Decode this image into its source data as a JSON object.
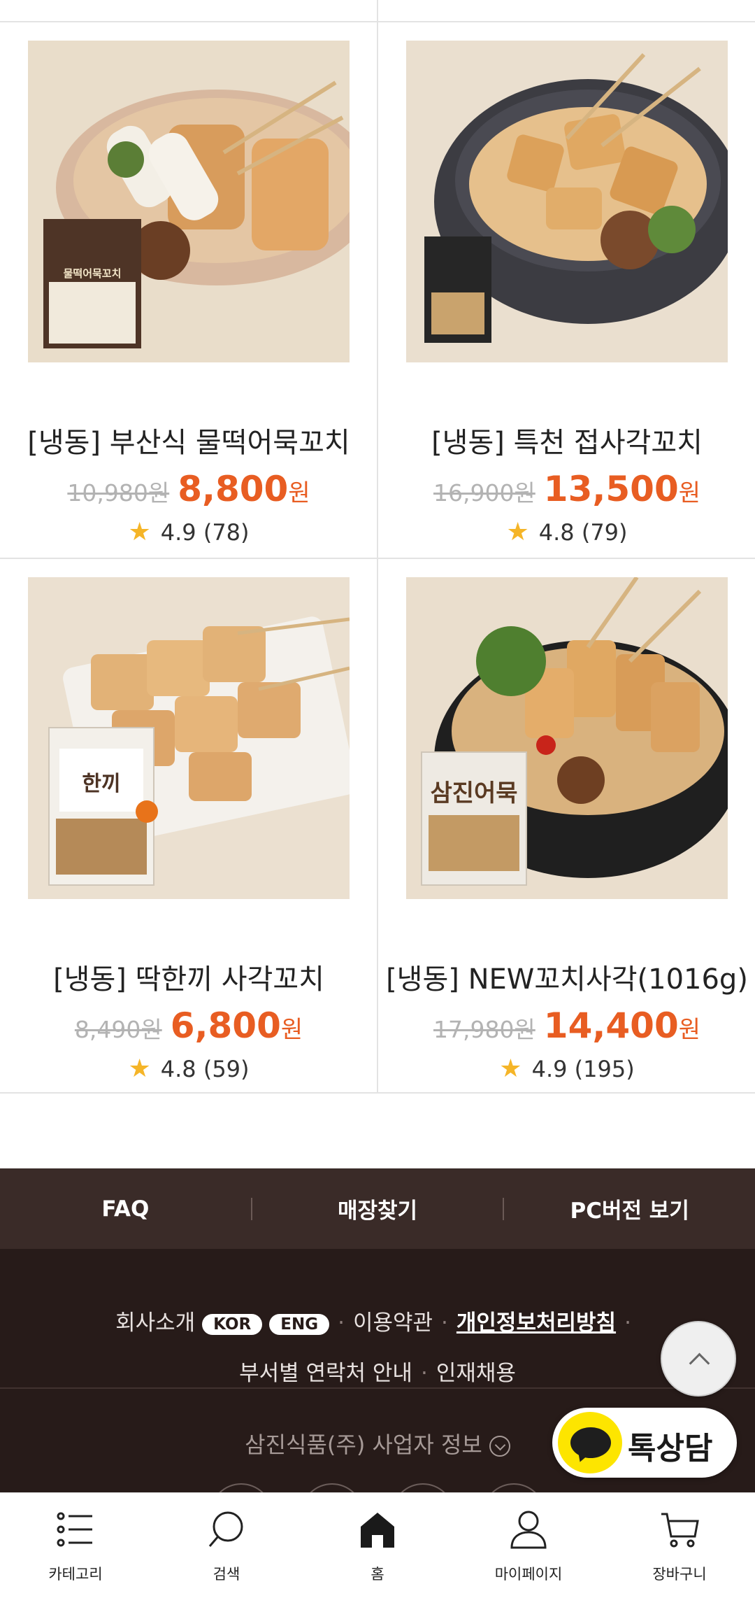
{
  "products": [
    {
      "name": "[냉동] 부산식 물떡어묵꼬치",
      "original_price": "10,980원",
      "sale_price": "8,800",
      "currency": "원",
      "rating": "4.9",
      "reviews": "(78)",
      "package_text": "물떡어묵꼬치"
    },
    {
      "name": "[냉동] 특천 접사각꼬치",
      "original_price": "16,900원",
      "sale_price": "13,500",
      "currency": "원",
      "rating": "4.8",
      "reviews": "(79)"
    },
    {
      "name": "[냉동] 딱한끼 사각꼬치",
      "original_price": "8,490원",
      "sale_price": "6,800",
      "currency": "원",
      "rating": "4.8",
      "reviews": "(59)",
      "package_text": "한끼"
    },
    {
      "name": "[냉동] NEW꼬치사각(1016g)",
      "original_price": "17,980원",
      "sale_price": "14,400",
      "currency": "원",
      "rating": "4.9",
      "reviews": "(195)",
      "package_text": "삼진어묵"
    }
  ],
  "footer_nav": [
    "FAQ",
    "매장찾기",
    "PC버전 보기"
  ],
  "footer_links": {
    "company": "회사소개",
    "kor": "KOR",
    "eng": "ENG",
    "terms": "이용약관",
    "privacy": "개인정보처리방침",
    "contact": "부서별 연락처 안내",
    "careers": "인재채용"
  },
  "business_info": "삼진식품(주) 사업자 정보",
  "talk_label": "톡상담",
  "tabbar": [
    {
      "label": "카테고리",
      "icon": "list-icon"
    },
    {
      "label": "검색",
      "icon": "search-icon"
    },
    {
      "label": "홈",
      "icon": "home-icon"
    },
    {
      "label": "마이페이지",
      "icon": "user-icon"
    },
    {
      "label": "장바구니",
      "icon": "cart-icon"
    }
  ],
  "colors": {
    "sale": "#e85d22",
    "star": "#f5b528",
    "footer_bg": "#271b19",
    "footer_nav_bg": "#3a2b28",
    "talk_yellow": "#fde500"
  }
}
